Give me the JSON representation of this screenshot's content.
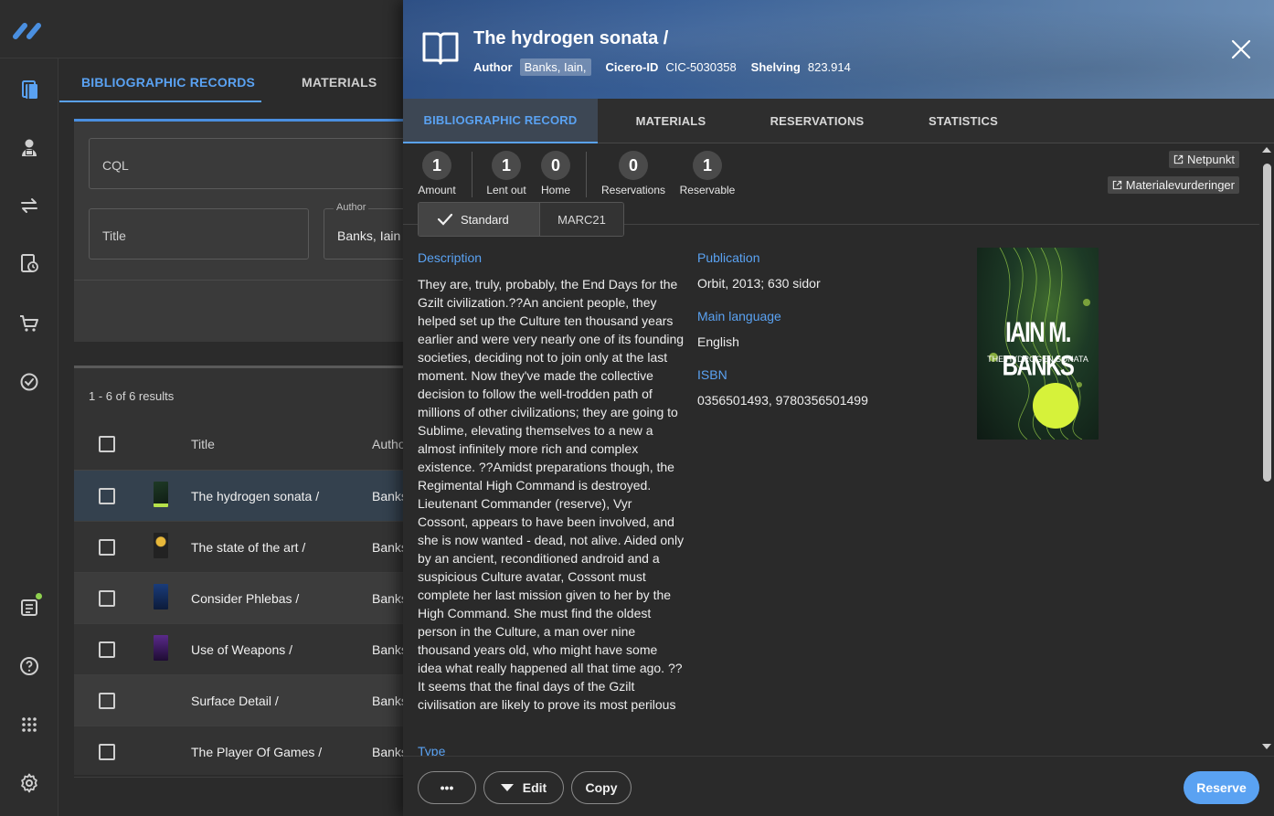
{
  "background": {
    "tabs": [
      "BIBLIOGRAPHIC RECORDS",
      "MATERIALS"
    ],
    "search": {
      "cql_placeholder": "CQL",
      "title_placeholder": "Title",
      "author_legend": "Author",
      "author_value": "Banks, Iain"
    },
    "results": {
      "count": "1 - 6 of 6 results",
      "col_title": "Title",
      "col_author": "Autho",
      "rows": [
        {
          "title": "The hydrogen sonata /",
          "author": "Banks"
        },
        {
          "title": "The state of the art /",
          "author": "Banks"
        },
        {
          "title": "Consider Phlebas /",
          "author": "Banks"
        },
        {
          "title": "Use of Weapons /",
          "author": "Banks"
        },
        {
          "title": "Surface Detail /",
          "author": "Banks"
        },
        {
          "title": "The Player Of Games /",
          "author": "Banks"
        }
      ]
    }
  },
  "detail": {
    "title": "The hydrogen sonata /",
    "author_key": "Author",
    "author_val": "Banks, Iain,",
    "cicero_key": "Cicero-ID",
    "cicero_val": "CIC-5030358",
    "shelving_key": "Shelving",
    "shelving_val": "823.914",
    "tabs": [
      "BIBLIOGRAPHIC RECORD",
      "MATERIALS",
      "RESERVATIONS",
      "STATISTICS"
    ],
    "stats": [
      {
        "value": "1",
        "label": "Amount"
      },
      {
        "value": "1",
        "label": "Lent out"
      },
      {
        "value": "0",
        "label": "Home"
      },
      {
        "value": "0",
        "label": "Reservations"
      },
      {
        "value": "1",
        "label": "Reservable"
      }
    ],
    "links": [
      "Netpunkt",
      "Materialevurderinger"
    ],
    "view_modes": [
      "Standard",
      "MARC21"
    ],
    "description_label": "Description",
    "description": "They are, truly, probably, the End Days for the Gzilt civilization.??An ancient people, they helped set up the Culture ten thousand years earlier and were very nearly one of its founding societies, deciding not to join only at the last moment. Now they've made the collective decision to follow the well-trodden path of millions of other civilizations; they are going to Sublime, elevating themselves to a new a almost infinitely more rich and complex existence. ??Amidst preparations though, the Regimental High Command is destroyed. Lieutenant Commander (reserve), Vyr Cossont, appears to have been involved, and she is now wanted - dead, not alive. Aided only by an ancient, reconditioned android and a suspicious Culture avatar, Cossont must complete her last mission given to her by the High Command. She must find the oldest person in the Culture, a man over nine thousand years old, who might have some idea what really happened all that time ago. ??It seems that the final days of the Gzilt civilisation are likely to prove its most perilous",
    "type_label": "Type",
    "publication_label": "Publication",
    "publication_val": "Orbit, 2013; 630 sidor",
    "language_label": "Main language",
    "language_val": "English",
    "isbn_label": "ISBN",
    "isbn_val": "0356501493, 9780356501499",
    "cover": {
      "author": "IAIN M. BANKS",
      "title": "THE HYDROGEN SONATA"
    },
    "footer": {
      "more": "•••",
      "edit": "Edit",
      "copy": "Copy",
      "reserve": "Reserve"
    }
  },
  "colors": {
    "accent": "#5aa2f2",
    "dot": "#8fd14f"
  }
}
